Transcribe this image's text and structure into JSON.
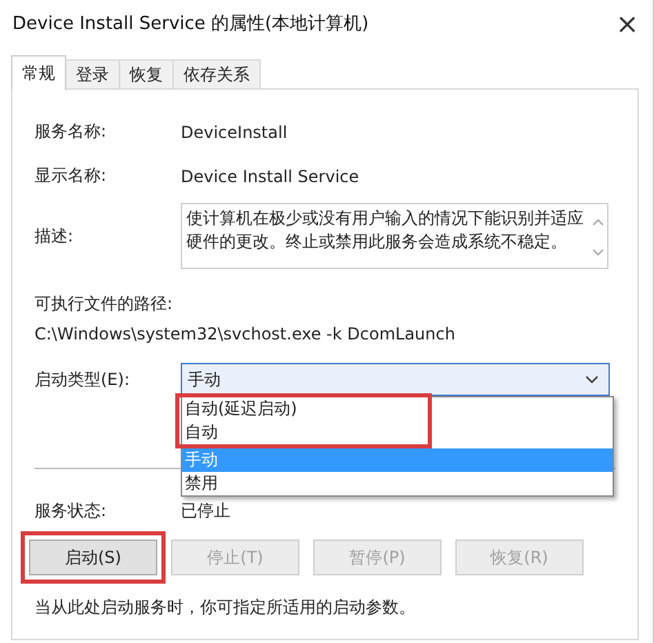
{
  "window": {
    "title": "Device Install Service 的属性(本地计算机)",
    "close": "×"
  },
  "tabs": [
    {
      "label": "常规",
      "selected": true
    },
    {
      "label": "登录",
      "selected": false
    },
    {
      "label": "恢复",
      "selected": false
    },
    {
      "label": "依存关系",
      "selected": false
    }
  ],
  "fields": [
    {
      "label": "服务名称:",
      "value": "DeviceInstall"
    },
    {
      "label": "显示名称:",
      "value": "Device Install Service"
    }
  ],
  "description": {
    "label": "描述:",
    "value": "使计算机在极少或没有用户输入的情况下能识别并适应硬件的更改。终止或禁用此服务会造成系统不稳定。"
  },
  "path": {
    "label": "可执行文件的路径:",
    "value": "C:\\Windows\\system32\\svchost.exe -k DcomLaunch"
  },
  "startup_type": {
    "label": "启动类型(E):",
    "value": "手动",
    "expanded": true,
    "options": [
      {
        "label": "自动(延迟启动)",
        "selected": false,
        "highlighted": true
      },
      {
        "label": "自动",
        "selected": false,
        "highlighted": true
      },
      {
        "label": "手动",
        "selected": true,
        "highlighted": false
      },
      {
        "label": "禁用",
        "selected": false,
        "highlighted": false
      }
    ]
  },
  "status": {
    "label": "服务状态:",
    "value": "已停止"
  },
  "buttons": [
    {
      "label": "启动(S)",
      "disabled": false,
      "highlighted": true
    },
    {
      "label": "停止(T)",
      "disabled": true,
      "highlighted": false
    },
    {
      "label": "暂停(P)",
      "disabled": true,
      "highlighted": false
    },
    {
      "label": "恢复(R)",
      "disabled": true,
      "highlighted": false
    }
  ],
  "hint": "当从此处启动服务时，你可指定所适用的启动参数。"
}
